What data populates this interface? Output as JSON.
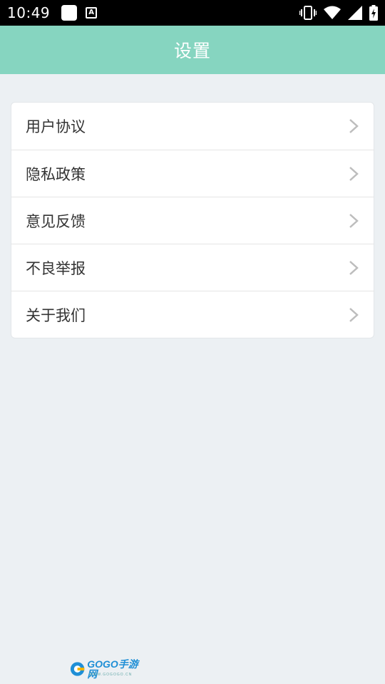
{
  "status_bar": {
    "time": "10:49",
    "notification_badge": "A",
    "icons": [
      "vibrate-icon",
      "wifi-icon",
      "signal-icon",
      "battery-charging-icon"
    ]
  },
  "header": {
    "title": "设置"
  },
  "settings": {
    "items": [
      {
        "label": "用户协议",
        "icon": "chevron-right-icon"
      },
      {
        "label": "隐私政策",
        "icon": "chevron-right-icon"
      },
      {
        "label": "意见反馈",
        "icon": "chevron-right-icon"
      },
      {
        "label": "不良举报",
        "icon": "chevron-right-icon"
      },
      {
        "label": "关于我们",
        "icon": "chevron-right-icon"
      }
    ]
  },
  "footer": {
    "logo_text": "GOGO手游网",
    "logo_sub": "WWW.GOGOGO.CN"
  },
  "colors": {
    "header_bg": "#86D5C0",
    "page_bg": "#ECF0F3",
    "status_bar_bg": "#000000",
    "logo_blue": "#1F8FD6"
  }
}
